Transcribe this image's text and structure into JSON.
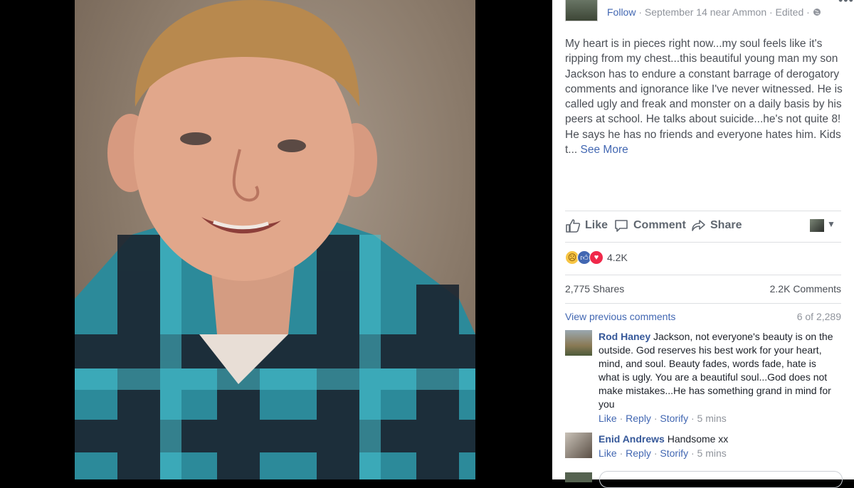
{
  "post": {
    "follow": "Follow",
    "meta": "· September 14 near Ammon · Edited ·",
    "privacy_icon": "globe-icon",
    "more": "•••",
    "text": "My heart is in pieces right now...my soul feels like it's ripping from my chest...this beautiful young man my son Jackson has to endure a constant barrage of derogatory comments and ignorance like I've never witnessed. He is called ugly and freak and monster on a daily basis by his peers at school. He talks about suicide...he's not quite 8! He says he has no friends and everyone hates him. Kids t...",
    "see_more": "See More"
  },
  "actions": {
    "like": "Like",
    "comment": "Comment",
    "share": "Share"
  },
  "reactions": {
    "icons": [
      "sad",
      "like",
      "love"
    ],
    "count": "4.2K"
  },
  "stats": {
    "shares": "2,775 Shares",
    "comments": "2.2K Comments"
  },
  "comments_header": {
    "view_previous": "View previous comments",
    "counter": "6 of 2,289"
  },
  "comments": [
    {
      "name": "Rod Haney",
      "text": "Jackson, not everyone's beauty is on the outside. God reserves his best work for your heart, mind, and soul. Beauty fades, words fade, hate is what is ugly. You are a beautiful soul...God does not make mistakes...He has something grand in mind for you",
      "like": "Like",
      "reply": "Reply",
      "storify": "Storify",
      "time": "5 mins"
    },
    {
      "name": "Enid Andrews",
      "text": "Handsome xx",
      "like": "Like",
      "reply": "Reply",
      "storify": "Storify",
      "time": "5 mins"
    }
  ],
  "colors": {
    "link": "#4267b2",
    "name": "#365899",
    "muted": "#90949c",
    "shirt_teal": "#3aa5b5",
    "shirt_dark": "#1b2530"
  }
}
